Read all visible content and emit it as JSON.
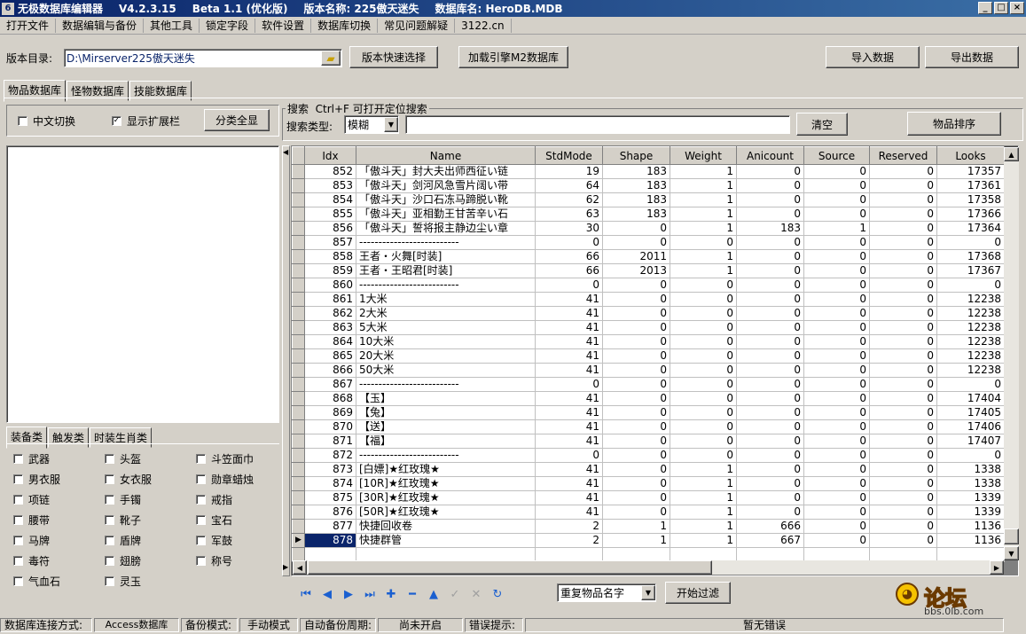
{
  "window": {
    "app_name": "无极数据库编辑器",
    "version": "V4.2.3.15",
    "beta": "Beta 1.1 (优化版)",
    "edition": "版本名称: 225傲天迷失",
    "db_name": "数据库名: HeroDB.MDB"
  },
  "menu": [
    "打开文件",
    "数据编辑与备份",
    "其他工具",
    "锁定字段",
    "软件设置",
    "数据库切换",
    "常见问题解疑",
    "3122.cn"
  ],
  "toolbar": {
    "dir_label": "版本目录:",
    "dir_value": "D:\\Mirserver225傲天迷失",
    "quick_select": "版本快速选择",
    "load_engine": "加载引擎M2数据库",
    "import": "导入数据",
    "export": "导出数据"
  },
  "db_tabs": [
    "物品数据库",
    "怪物数据库",
    "技能数据库"
  ],
  "left": {
    "chinese_toggle": "中文切换",
    "show_ext": "显示扩展栏",
    "show_all": "分类全显",
    "cat_tabs": [
      "装备类",
      "触发类",
      "时装生肖类"
    ],
    "categories": [
      [
        "武器",
        "头盔",
        "斗笠面巾"
      ],
      [
        "男衣服",
        "女衣服",
        "勋章蜡烛"
      ],
      [
        "项链",
        "手镯",
        "戒指"
      ],
      [
        "腰带",
        "靴子",
        "宝石"
      ],
      [
        "马牌",
        "盾牌",
        "军鼓"
      ],
      [
        "毒符",
        "翅膀",
        "称号"
      ],
      [
        "气血石",
        "灵玉",
        ""
      ]
    ]
  },
  "search": {
    "legend": "搜索  Ctrl+F 可打开定位搜索",
    "type_label": "搜索类型:",
    "type_value": "模糊",
    "query": "",
    "clear": "清空",
    "sort": "物品排序"
  },
  "grid": {
    "columns": [
      "Idx",
      "Name",
      "StdMode",
      "Shape",
      "Weight",
      "Anicount",
      "Source",
      "Reserved",
      "Looks"
    ],
    "rows": [
      [
        "852",
        "「傲斗天」封大夫出师西征い链",
        "19",
        "183",
        "1",
        "0",
        "0",
        "0",
        "17357"
      ],
      [
        "853",
        "「傲斗天」剑河风急雪片阔い带",
        "64",
        "183",
        "1",
        "0",
        "0",
        "0",
        "17361"
      ],
      [
        "854",
        "「傲斗天」沙口石冻马蹄脱い靴",
        "62",
        "183",
        "1",
        "0",
        "0",
        "0",
        "17358"
      ],
      [
        "855",
        "「傲斗天」亚相勤王甘苦辛い石",
        "63",
        "183",
        "1",
        "0",
        "0",
        "0",
        "17366"
      ],
      [
        "856",
        "「傲斗天」誓将报主静边尘い章",
        "30",
        "0",
        "1",
        "183",
        "1",
        "0",
        "17364"
      ],
      [
        "857",
        "--------------------------",
        "0",
        "0",
        "0",
        "0",
        "0",
        "0",
        "0"
      ],
      [
        "858",
        "王者・火舞[时装]",
        "66",
        "2011",
        "1",
        "0",
        "0",
        "0",
        "17368"
      ],
      [
        "859",
        "王者・王昭君[时装]",
        "66",
        "2013",
        "1",
        "0",
        "0",
        "0",
        "17367"
      ],
      [
        "860",
        "--------------------------",
        "0",
        "0",
        "0",
        "0",
        "0",
        "0",
        "0"
      ],
      [
        "861",
        "1大米",
        "41",
        "0",
        "0",
        "0",
        "0",
        "0",
        "12238"
      ],
      [
        "862",
        "2大米",
        "41",
        "0",
        "0",
        "0",
        "0",
        "0",
        "12238"
      ],
      [
        "863",
        "5大米",
        "41",
        "0",
        "0",
        "0",
        "0",
        "0",
        "12238"
      ],
      [
        "864",
        "10大米",
        "41",
        "0",
        "0",
        "0",
        "0",
        "0",
        "12238"
      ],
      [
        "865",
        "20大米",
        "41",
        "0",
        "0",
        "0",
        "0",
        "0",
        "12238"
      ],
      [
        "866",
        "50大米",
        "41",
        "0",
        "0",
        "0",
        "0",
        "0",
        "12238"
      ],
      [
        "867",
        "--------------------------",
        "0",
        "0",
        "0",
        "0",
        "0",
        "0",
        "0"
      ],
      [
        "868",
        "【玉】",
        "41",
        "0",
        "0",
        "0",
        "0",
        "0",
        "17404"
      ],
      [
        "869",
        "【兔】",
        "41",
        "0",
        "0",
        "0",
        "0",
        "0",
        "17405"
      ],
      [
        "870",
        "【送】",
        "41",
        "0",
        "0",
        "0",
        "0",
        "0",
        "17406"
      ],
      [
        "871",
        "【福】",
        "41",
        "0",
        "0",
        "0",
        "0",
        "0",
        "17407"
      ],
      [
        "872",
        "--------------------------",
        "0",
        "0",
        "0",
        "0",
        "0",
        "0",
        "0"
      ],
      [
        "873",
        "[白嫖]★红玫瑰★",
        "41",
        "0",
        "1",
        "0",
        "0",
        "0",
        "1338"
      ],
      [
        "874",
        "[10R]★红玫瑰★",
        "41",
        "0",
        "1",
        "0",
        "0",
        "0",
        "1338"
      ],
      [
        "875",
        "[30R]★红玫瑰★",
        "41",
        "0",
        "1",
        "0",
        "0",
        "0",
        "1339"
      ],
      [
        "876",
        "[50R]★红玫瑰★",
        "41",
        "0",
        "1",
        "0",
        "0",
        "0",
        "1339"
      ],
      [
        "877",
        "快捷回收卷",
        "2",
        "1",
        "1",
        "666",
        "0",
        "0",
        "1136"
      ],
      [
        "878",
        "快捷群管",
        "2",
        "1",
        "1",
        "667",
        "0",
        "0",
        "1136"
      ]
    ],
    "selected_row": 26
  },
  "bottom": {
    "filter_type": "重复物品名字",
    "start_filter": "开始过滤",
    "nav_icons": [
      "first-icon",
      "prev-icon",
      "next-icon",
      "last-icon",
      "add-icon",
      "delete-icon",
      "up-icon",
      "check-icon",
      "cancel-icon",
      "refresh-icon"
    ]
  },
  "statusbar": {
    "conn_label": "数据库连接方式:",
    "conn_value": "Access数据库",
    "backup_label": "备份模式:",
    "backup_value": "手动模式",
    "auto_label": "自动备份周期:",
    "auto_value": "尚未开启",
    "error_label": "错误提示:",
    "error_value": "暂无错误"
  },
  "watermark": {
    "text": "论坛",
    "url": "bbs.0lb.com"
  },
  "colors": {
    "title_start": "#0a246a",
    "title_end": "#3a6ea5",
    "face": "#d4d0c8",
    "nav_blue": "#1a5fd0"
  }
}
